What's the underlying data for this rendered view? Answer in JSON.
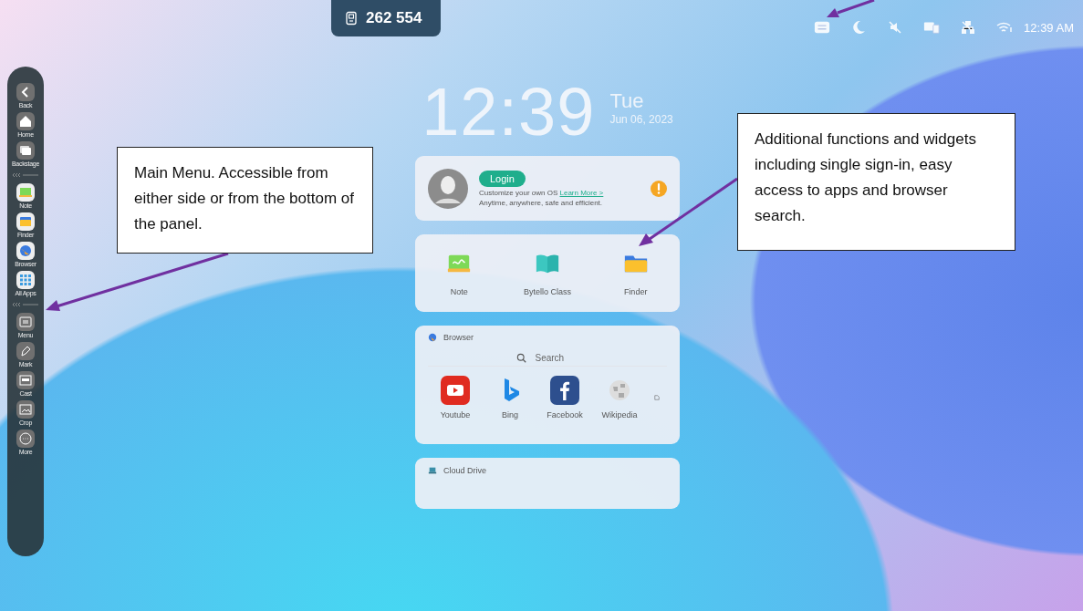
{
  "room_code": {
    "text": "262 554"
  },
  "status_bar": {
    "time": "12:39 AM"
  },
  "clock": {
    "time": "12:39",
    "weekday": "Tue",
    "date": "Jun 06, 2023"
  },
  "sidebar": {
    "groups": [
      [
        {
          "label": "Back",
          "kind": "back"
        },
        {
          "label": "Home",
          "kind": "home"
        },
        {
          "label": "Backstage",
          "kind": "backstage"
        }
      ],
      [
        {
          "label": "Note",
          "kind": "note"
        },
        {
          "label": "Finder",
          "kind": "finder"
        },
        {
          "label": "Browser",
          "kind": "browser"
        },
        {
          "label": "All Apps",
          "kind": "apps"
        }
      ],
      [
        {
          "label": "Menu",
          "kind": "menu"
        },
        {
          "label": "Mark",
          "kind": "mark"
        },
        {
          "label": "Cast",
          "kind": "cast"
        },
        {
          "label": "Crop",
          "kind": "crop"
        },
        {
          "label": "More",
          "kind": "more"
        }
      ]
    ]
  },
  "account_card": {
    "button": "Login",
    "line_1": "Customize your own OS",
    "link": "Learn More >",
    "line_2": "Anytime, anywhere, safe and efficient."
  },
  "apps_card": {
    "apps": [
      {
        "label": "Note",
        "kind": "note"
      },
      {
        "label": "Bytello Class",
        "kind": "book"
      },
      {
        "label": "Finder",
        "kind": "finder"
      }
    ]
  },
  "browser_card": {
    "title": "Browser",
    "search": {
      "placeholder": "Search"
    },
    "shortcuts": [
      {
        "label": "Youtube",
        "kind": "youtube"
      },
      {
        "label": "Bing",
        "kind": "bing"
      },
      {
        "label": "Facebook",
        "kind": "facebook"
      },
      {
        "label": "Wikipedia",
        "kind": "wikipedia"
      }
    ]
  },
  "cloud_card": {
    "title": "Cloud Drive"
  },
  "callouts": [
    {
      "text": "Main Menu. Accessible from either side or from the bottom of the panel."
    },
    {
      "text": "Additional functions and widgets including single sign-in, easy access to apps and browser search."
    }
  ]
}
